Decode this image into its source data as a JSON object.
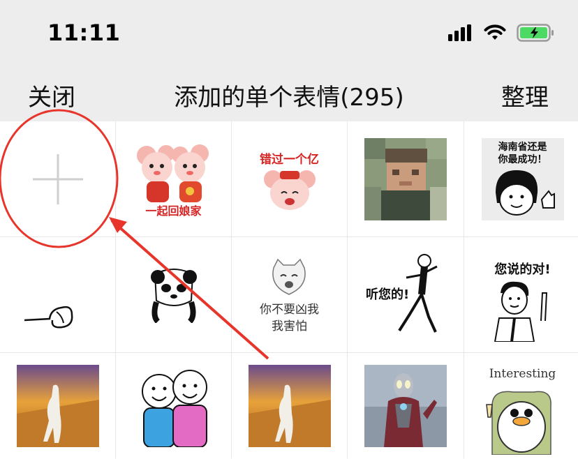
{
  "status": {
    "time": "11:11"
  },
  "nav": {
    "close": "关闭",
    "title": "添加的单个表情(295)",
    "sort": "整理"
  },
  "stickers": {
    "s2_caption": "一起回娘家",
    "s3_caption": "错过一个亿",
    "s5_caption": "海南省还是\n你最成功！",
    "s5_line1": "海南省还是",
    "s5_line2": "你最成功！",
    "s8_line1": "你不要凶我",
    "s8_line2": "我害怕",
    "s9_caption": "听您的!",
    "s10_caption": "您说的对!",
    "s15_caption": "Interesting"
  },
  "colors": {
    "annotation": "#e8352b",
    "battery": "#4cd964"
  }
}
